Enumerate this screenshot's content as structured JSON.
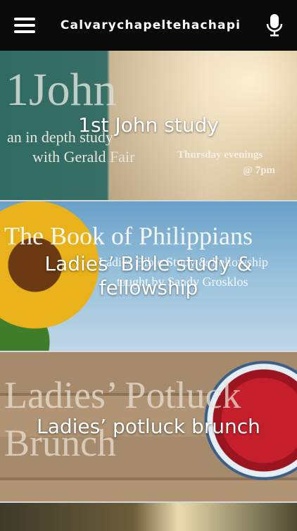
{
  "header": {
    "title": "Calvarychapeltehachapi",
    "menu_icon": "hamburger-menu-icon",
    "mic_icon": "microphone-icon"
  },
  "cards": [
    {
      "title": "1st John study",
      "bg_text": [
        "1John",
        "an in depth study",
        "with Gerald Fair",
        "Thursday evenings",
        "@ 7pm"
      ]
    },
    {
      "title": "Ladies’ Bible study & fellowship",
      "bg_text": [
        "The Book of Philippians",
        "Ladies Bible Study & Fellowship",
        "taught by Sandy Grosklos"
      ]
    },
    {
      "title": "Ladies’ potluck brunch",
      "bg_text": [
        "Ladies’ Potluck",
        "Brunch"
      ]
    }
  ],
  "colors": {
    "topbar": "#0a0a0a",
    "title_text": "#ffffff",
    "divider": "#d8d8d8"
  }
}
